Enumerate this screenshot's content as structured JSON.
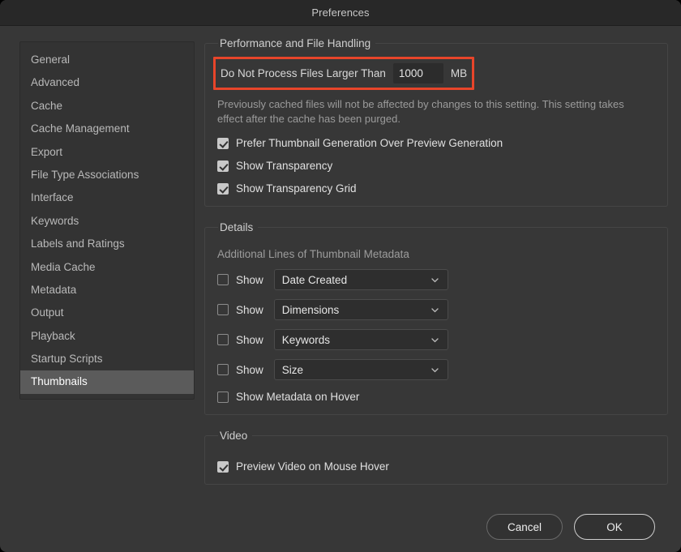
{
  "window": {
    "title": "Preferences"
  },
  "sidebar": {
    "items": [
      {
        "label": "General",
        "selected": false
      },
      {
        "label": "Advanced",
        "selected": false
      },
      {
        "label": "Cache",
        "selected": false
      },
      {
        "label": "Cache Management",
        "selected": false
      },
      {
        "label": "Export",
        "selected": false
      },
      {
        "label": "File Type Associations",
        "selected": false
      },
      {
        "label": "Interface",
        "selected": false
      },
      {
        "label": "Keywords",
        "selected": false
      },
      {
        "label": "Labels and Ratings",
        "selected": false
      },
      {
        "label": "Media Cache",
        "selected": false
      },
      {
        "label": "Metadata",
        "selected": false
      },
      {
        "label": "Output",
        "selected": false
      },
      {
        "label": "Playback",
        "selected": false
      },
      {
        "label": "Startup Scripts",
        "selected": false
      },
      {
        "label": "Thumbnails",
        "selected": true
      }
    ]
  },
  "performance": {
    "legend": "Performance and File Handling",
    "limit_label": "Do Not Process Files Larger Than",
    "limit_value": "1000",
    "limit_unit": "MB",
    "highlight_color": "#e8452a",
    "note": "Previously cached files will not be affected by changes to this setting. This setting takes effect after the cache has been purged.",
    "checkboxes": [
      {
        "label": "Prefer Thumbnail Generation Over Preview Generation",
        "checked": true
      },
      {
        "label": "Show Transparency",
        "checked": true
      },
      {
        "label": "Show Transparency Grid",
        "checked": true
      }
    ]
  },
  "details": {
    "legend": "Details",
    "sub_label": "Additional Lines of Thumbnail Metadata",
    "rows": [
      {
        "show_label": "Show",
        "checked": false,
        "value": "Date Created"
      },
      {
        "show_label": "Show",
        "checked": false,
        "value": "Dimensions"
      },
      {
        "show_label": "Show",
        "checked": false,
        "value": "Keywords"
      },
      {
        "show_label": "Show",
        "checked": false,
        "value": "Size"
      }
    ],
    "hover_checkbox": {
      "label": "Show Metadata on Hover",
      "checked": false
    }
  },
  "video": {
    "legend": "Video",
    "checkbox": {
      "label": "Preview Video on Mouse Hover",
      "checked": true
    }
  },
  "footer": {
    "cancel_label": "Cancel",
    "ok_label": "OK"
  }
}
